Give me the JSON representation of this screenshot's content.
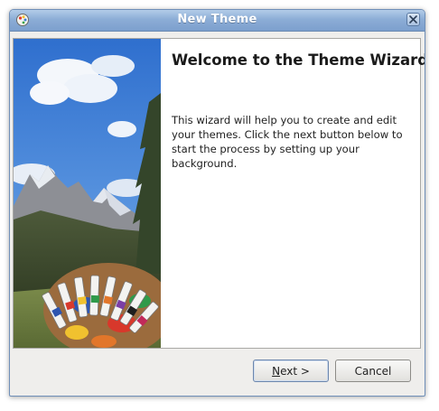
{
  "window": {
    "title": "New Theme",
    "app_icon": "theme-wizard-app-icon",
    "close_icon": "close-icon"
  },
  "side_image": {
    "description_icon": "mountain-landscape-with-paint-tubes-image"
  },
  "main": {
    "heading": "Welcome to the Theme Wizard",
    "description": "This wizard will help you to create and edit your themes. Click the next button below to start the process by setting up your background."
  },
  "buttons": {
    "next_mnemonic": "N",
    "next_rest": "ext >",
    "cancel_label": "Cancel"
  },
  "colors": {
    "titlebar": "#8cadd6",
    "dialog_bg": "#efeeec",
    "content_bg": "#ffffff"
  }
}
